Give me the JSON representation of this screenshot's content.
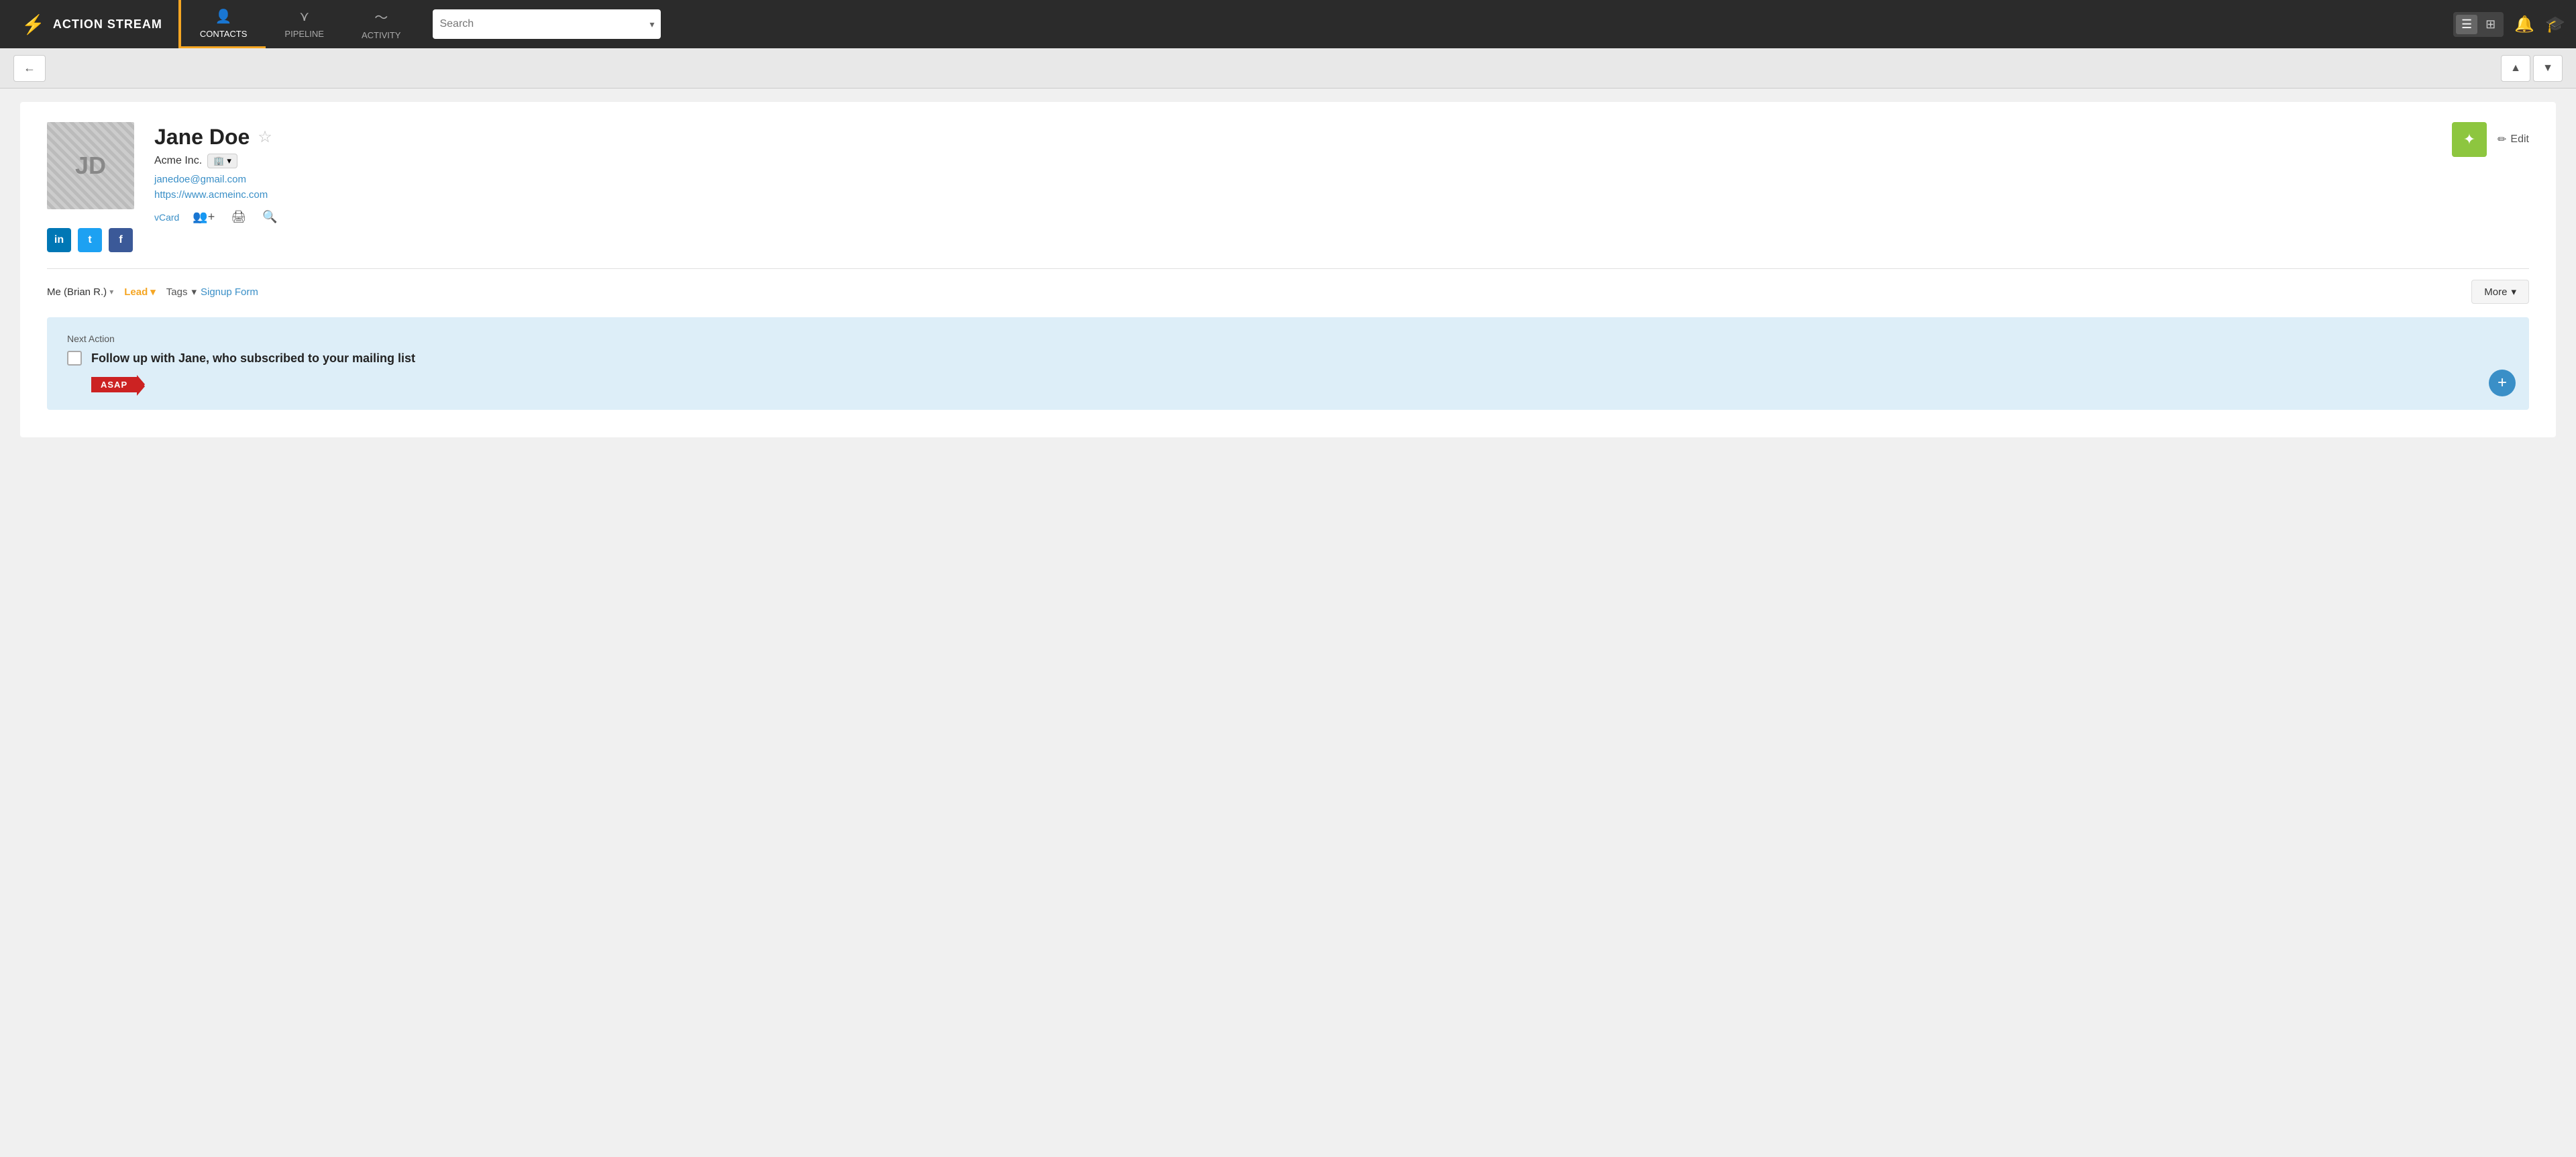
{
  "brand": {
    "icon": "⚡",
    "name": "ACTION STREAM"
  },
  "nav": {
    "items": [
      {
        "id": "contacts",
        "label": "CONTACTS",
        "icon": "👤",
        "active": true
      },
      {
        "id": "pipeline",
        "label": "PIPELINE",
        "icon": "▽",
        "active": false
      },
      {
        "id": "activity",
        "label": "ACTIVITY",
        "icon": "📈",
        "active": false
      }
    ]
  },
  "search": {
    "placeholder": "Search",
    "value": ""
  },
  "toolbar": {
    "back_label": "←",
    "up_label": "▲",
    "down_label": "▼"
  },
  "contact": {
    "initials": "JD",
    "name": "Jane Doe",
    "company": "Acme Inc.",
    "email": "janedoe@gmail.com",
    "website": "https://www.acmeinc.com",
    "vcard_label": "vCard",
    "star_icon": "☆",
    "edit_label": "Edit",
    "magic_icon": "✦",
    "pencil_icon": "✏",
    "print_icon": "🖨",
    "search_icon": "🔍",
    "add_contact_icon": "👥",
    "social": {
      "linkedin": "in",
      "twitter": "t",
      "facebook": "f"
    }
  },
  "status": {
    "owner": "Me (Brian R.)",
    "lead_label": "Lead",
    "tags_label": "Tags",
    "signup_form_label": "Signup Form",
    "more_label": "More"
  },
  "next_action": {
    "label": "Next Action",
    "text": "Follow up with Jane, who subscribed to your mailing list",
    "priority_label": "ASAP",
    "add_icon": "+"
  }
}
